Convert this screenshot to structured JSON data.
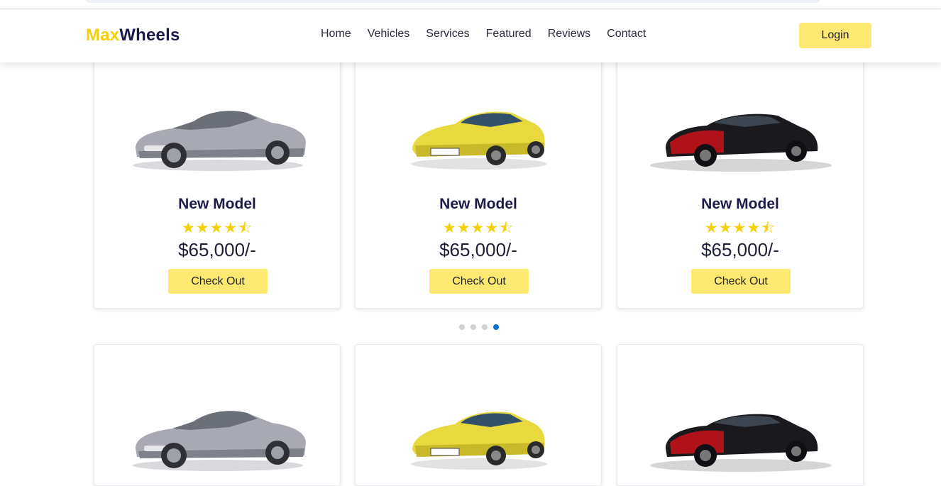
{
  "brand": {
    "part1": "Max",
    "part2": "Wheels"
  },
  "nav": [
    "Home",
    "Vehicles",
    "Services",
    "Featured",
    "Reviews",
    "Contact"
  ],
  "login_label": "Login",
  "cards": [
    {
      "title": "New Model",
      "price": "$65,000/-",
      "button": "Check Out",
      "rating": 4.5,
      "car": "silver-convertible"
    },
    {
      "title": "New Model",
      "price": "$65,000/-",
      "button": "Check Out",
      "rating": 4.5,
      "car": "yellow-coupe"
    },
    {
      "title": "New Model",
      "price": "$65,000/-",
      "button": "Check Out",
      "rating": 4.5,
      "car": "red-black-supercar"
    }
  ],
  "carousel": {
    "count": 4,
    "active": 4
  },
  "colors": {
    "accent": "#f5cf0a",
    "button": "#fde872",
    "dot_active": "#0a6fe0",
    "text_dark": "#1b1a4a"
  }
}
